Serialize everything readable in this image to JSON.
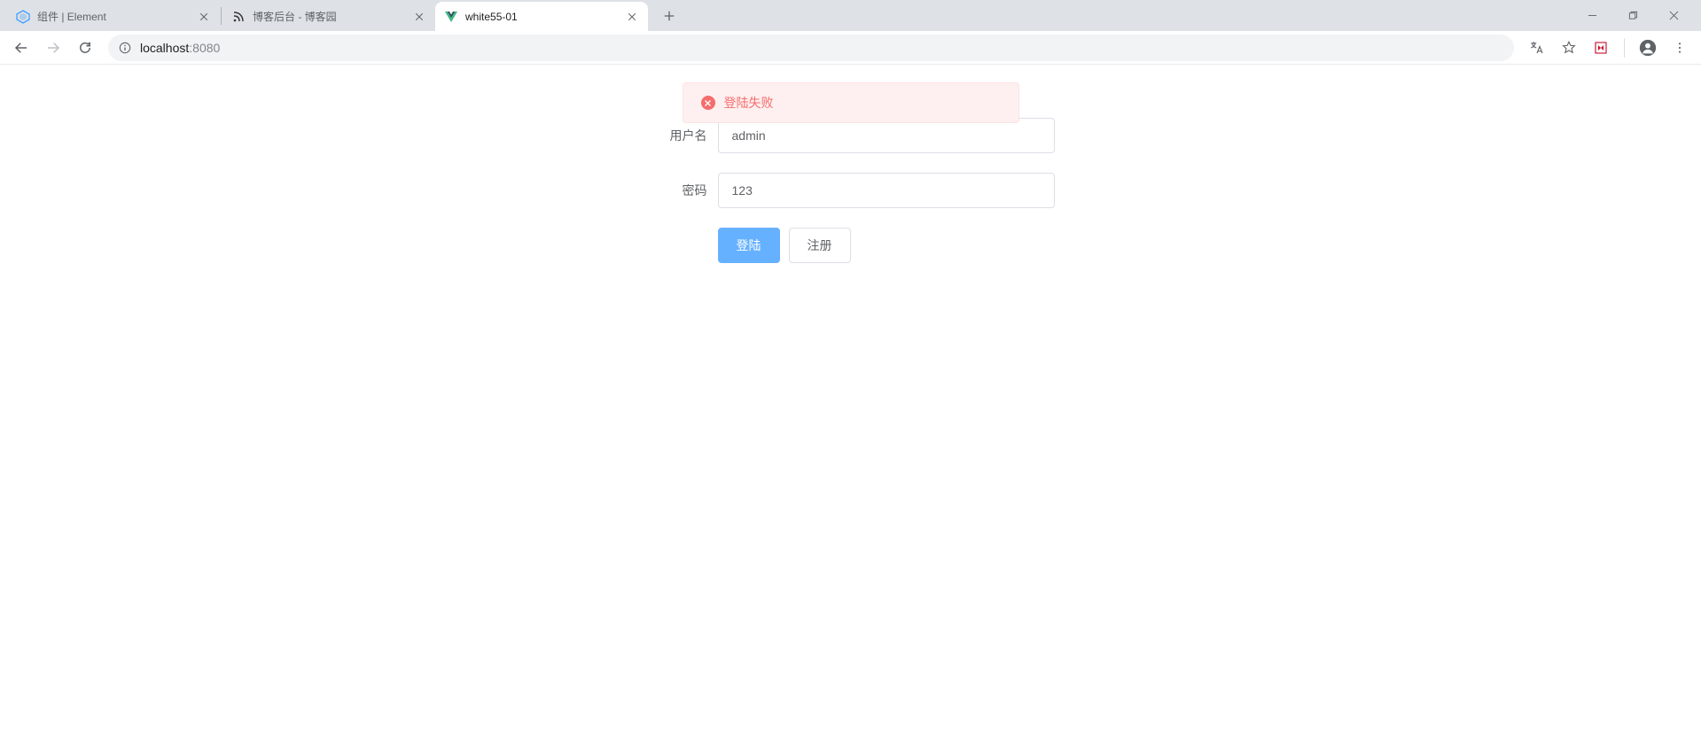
{
  "browser": {
    "tabs": [
      {
        "title": "组件 | Element",
        "active": false
      },
      {
        "title": "博客后台 - 博客园",
        "active": false
      },
      {
        "title": "white55-01",
        "active": true
      }
    ],
    "url_host": "localhost",
    "url_port": ":8080"
  },
  "message": {
    "text": "登陆失败"
  },
  "form": {
    "username_label": "用户名",
    "username_value": "admin",
    "password_label": "密码",
    "password_value": "123",
    "login_label": "登陆",
    "register_label": "注册"
  }
}
